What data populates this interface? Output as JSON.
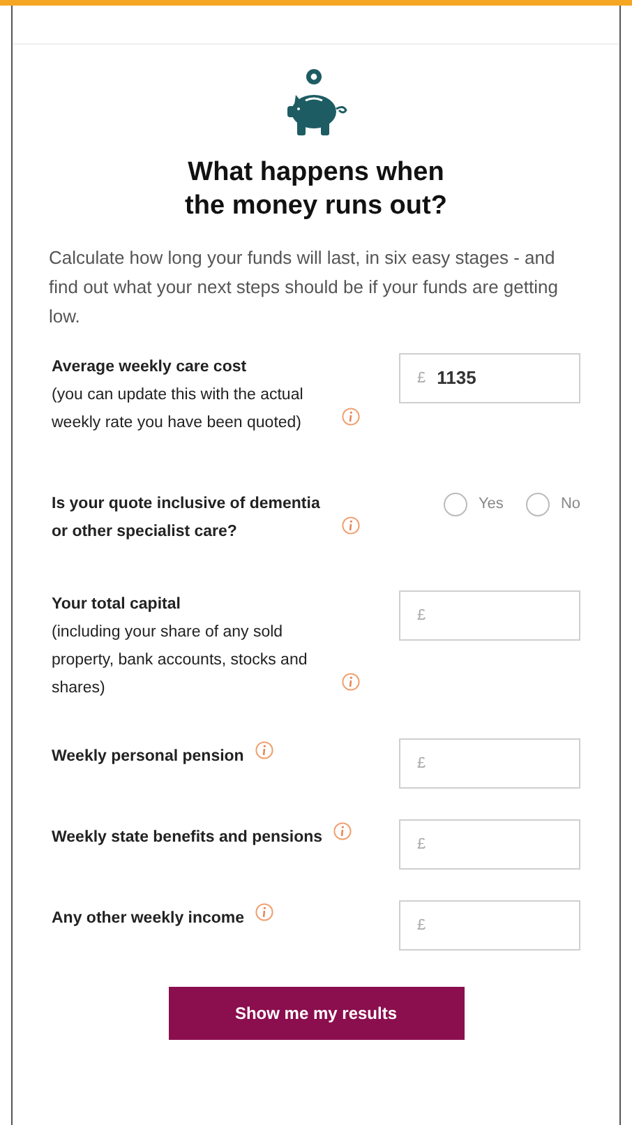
{
  "title": "What happens when the money runs out?",
  "intro": "Calculate how long your funds will last, in six easy stages - and find out what your next steps should be if your funds are getting low.",
  "fields": [
    {
      "kind": "input",
      "label": "Average weekly care cost",
      "note": "(you can update this with the actual weekly rate you have been quoted)",
      "prefix": "£",
      "value": "1135"
    },
    {
      "kind": "radio",
      "label": "Is your quote inclusive of dementia or other specialist care?",
      "options": [
        {
          "label": "Yes",
          "selected": false
        },
        {
          "label": "No",
          "selected": false
        }
      ]
    },
    {
      "kind": "input",
      "label": "Your total capital",
      "note": "(including your share of any sold property, bank accounts, stocks and shares)",
      "prefix": "£"
    },
    {
      "kind": "input",
      "label": "Weekly personal pension",
      "prefix": "£"
    },
    {
      "kind": "input",
      "label": "Weekly state benefits and pensions",
      "prefix": "£"
    },
    {
      "kind": "input",
      "label": "Any other weekly income",
      "prefix": "£"
    }
  ],
  "button": "Show me my results"
}
